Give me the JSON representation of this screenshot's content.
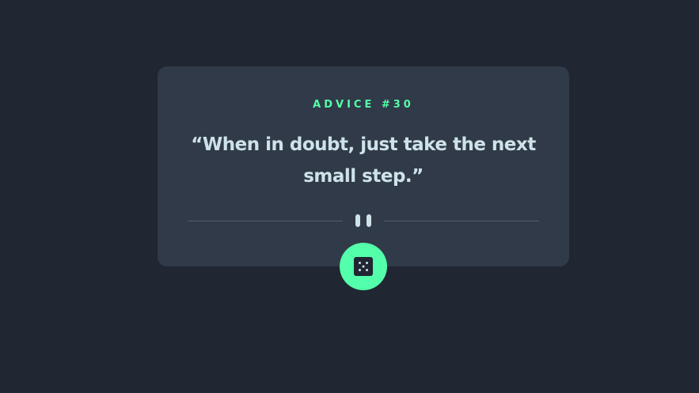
{
  "card": {
    "advice_id": "ADVICE #30",
    "quote": "“When in doubt, just take the next small step.”"
  },
  "icons": {
    "divider": "pause-icon",
    "button": "dice-icon"
  },
  "colors": {
    "background": "#202632",
    "card": "#313a48",
    "accent": "#53ffaa",
    "text": "#cee3e9",
    "divider": "#4f5d74"
  }
}
